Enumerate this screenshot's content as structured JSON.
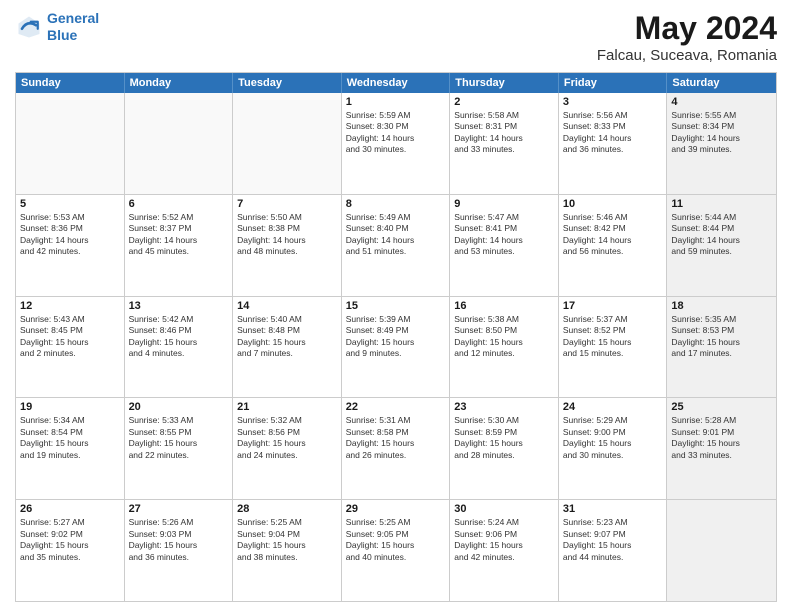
{
  "logo": {
    "line1": "General",
    "line2": "Blue"
  },
  "title": "May 2024",
  "subtitle": "Falcau, Suceava, Romania",
  "header_days": [
    "Sunday",
    "Monday",
    "Tuesday",
    "Wednesday",
    "Thursday",
    "Friday",
    "Saturday"
  ],
  "rows": [
    [
      {
        "day": "",
        "text": "",
        "shaded": false,
        "empty": true
      },
      {
        "day": "",
        "text": "",
        "shaded": false,
        "empty": true
      },
      {
        "day": "",
        "text": "",
        "shaded": false,
        "empty": true
      },
      {
        "day": "1",
        "text": "Sunrise: 5:59 AM\nSunset: 8:30 PM\nDaylight: 14 hours\nand 30 minutes.",
        "shaded": false,
        "empty": false
      },
      {
        "day": "2",
        "text": "Sunrise: 5:58 AM\nSunset: 8:31 PM\nDaylight: 14 hours\nand 33 minutes.",
        "shaded": false,
        "empty": false
      },
      {
        "day": "3",
        "text": "Sunrise: 5:56 AM\nSunset: 8:33 PM\nDaylight: 14 hours\nand 36 minutes.",
        "shaded": false,
        "empty": false
      },
      {
        "day": "4",
        "text": "Sunrise: 5:55 AM\nSunset: 8:34 PM\nDaylight: 14 hours\nand 39 minutes.",
        "shaded": true,
        "empty": false
      }
    ],
    [
      {
        "day": "5",
        "text": "Sunrise: 5:53 AM\nSunset: 8:36 PM\nDaylight: 14 hours\nand 42 minutes.",
        "shaded": false,
        "empty": false
      },
      {
        "day": "6",
        "text": "Sunrise: 5:52 AM\nSunset: 8:37 PM\nDaylight: 14 hours\nand 45 minutes.",
        "shaded": false,
        "empty": false
      },
      {
        "day": "7",
        "text": "Sunrise: 5:50 AM\nSunset: 8:38 PM\nDaylight: 14 hours\nand 48 minutes.",
        "shaded": false,
        "empty": false
      },
      {
        "day": "8",
        "text": "Sunrise: 5:49 AM\nSunset: 8:40 PM\nDaylight: 14 hours\nand 51 minutes.",
        "shaded": false,
        "empty": false
      },
      {
        "day": "9",
        "text": "Sunrise: 5:47 AM\nSunset: 8:41 PM\nDaylight: 14 hours\nand 53 minutes.",
        "shaded": false,
        "empty": false
      },
      {
        "day": "10",
        "text": "Sunrise: 5:46 AM\nSunset: 8:42 PM\nDaylight: 14 hours\nand 56 minutes.",
        "shaded": false,
        "empty": false
      },
      {
        "day": "11",
        "text": "Sunrise: 5:44 AM\nSunset: 8:44 PM\nDaylight: 14 hours\nand 59 minutes.",
        "shaded": true,
        "empty": false
      }
    ],
    [
      {
        "day": "12",
        "text": "Sunrise: 5:43 AM\nSunset: 8:45 PM\nDaylight: 15 hours\nand 2 minutes.",
        "shaded": false,
        "empty": false
      },
      {
        "day": "13",
        "text": "Sunrise: 5:42 AM\nSunset: 8:46 PM\nDaylight: 15 hours\nand 4 minutes.",
        "shaded": false,
        "empty": false
      },
      {
        "day": "14",
        "text": "Sunrise: 5:40 AM\nSunset: 8:48 PM\nDaylight: 15 hours\nand 7 minutes.",
        "shaded": false,
        "empty": false
      },
      {
        "day": "15",
        "text": "Sunrise: 5:39 AM\nSunset: 8:49 PM\nDaylight: 15 hours\nand 9 minutes.",
        "shaded": false,
        "empty": false
      },
      {
        "day": "16",
        "text": "Sunrise: 5:38 AM\nSunset: 8:50 PM\nDaylight: 15 hours\nand 12 minutes.",
        "shaded": false,
        "empty": false
      },
      {
        "day": "17",
        "text": "Sunrise: 5:37 AM\nSunset: 8:52 PM\nDaylight: 15 hours\nand 15 minutes.",
        "shaded": false,
        "empty": false
      },
      {
        "day": "18",
        "text": "Sunrise: 5:35 AM\nSunset: 8:53 PM\nDaylight: 15 hours\nand 17 minutes.",
        "shaded": true,
        "empty": false
      }
    ],
    [
      {
        "day": "19",
        "text": "Sunrise: 5:34 AM\nSunset: 8:54 PM\nDaylight: 15 hours\nand 19 minutes.",
        "shaded": false,
        "empty": false
      },
      {
        "day": "20",
        "text": "Sunrise: 5:33 AM\nSunset: 8:55 PM\nDaylight: 15 hours\nand 22 minutes.",
        "shaded": false,
        "empty": false
      },
      {
        "day": "21",
        "text": "Sunrise: 5:32 AM\nSunset: 8:56 PM\nDaylight: 15 hours\nand 24 minutes.",
        "shaded": false,
        "empty": false
      },
      {
        "day": "22",
        "text": "Sunrise: 5:31 AM\nSunset: 8:58 PM\nDaylight: 15 hours\nand 26 minutes.",
        "shaded": false,
        "empty": false
      },
      {
        "day": "23",
        "text": "Sunrise: 5:30 AM\nSunset: 8:59 PM\nDaylight: 15 hours\nand 28 minutes.",
        "shaded": false,
        "empty": false
      },
      {
        "day": "24",
        "text": "Sunrise: 5:29 AM\nSunset: 9:00 PM\nDaylight: 15 hours\nand 30 minutes.",
        "shaded": false,
        "empty": false
      },
      {
        "day": "25",
        "text": "Sunrise: 5:28 AM\nSunset: 9:01 PM\nDaylight: 15 hours\nand 33 minutes.",
        "shaded": true,
        "empty": false
      }
    ],
    [
      {
        "day": "26",
        "text": "Sunrise: 5:27 AM\nSunset: 9:02 PM\nDaylight: 15 hours\nand 35 minutes.",
        "shaded": false,
        "empty": false
      },
      {
        "day": "27",
        "text": "Sunrise: 5:26 AM\nSunset: 9:03 PM\nDaylight: 15 hours\nand 36 minutes.",
        "shaded": false,
        "empty": false
      },
      {
        "day": "28",
        "text": "Sunrise: 5:25 AM\nSunset: 9:04 PM\nDaylight: 15 hours\nand 38 minutes.",
        "shaded": false,
        "empty": false
      },
      {
        "day": "29",
        "text": "Sunrise: 5:25 AM\nSunset: 9:05 PM\nDaylight: 15 hours\nand 40 minutes.",
        "shaded": false,
        "empty": false
      },
      {
        "day": "30",
        "text": "Sunrise: 5:24 AM\nSunset: 9:06 PM\nDaylight: 15 hours\nand 42 minutes.",
        "shaded": false,
        "empty": false
      },
      {
        "day": "31",
        "text": "Sunrise: 5:23 AM\nSunset: 9:07 PM\nDaylight: 15 hours\nand 44 minutes.",
        "shaded": false,
        "empty": false
      },
      {
        "day": "",
        "text": "",
        "shaded": true,
        "empty": true
      }
    ]
  ]
}
